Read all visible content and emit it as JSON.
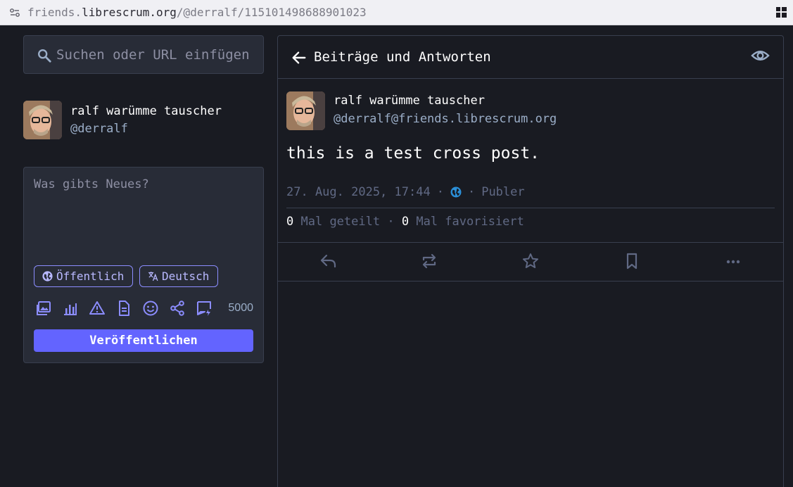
{
  "browser": {
    "url_prefix": "friends.",
    "url_domain": "librescrum.org",
    "url_path": "/@derralf/115101498688901023"
  },
  "sidebar": {
    "search_placeholder": "Suchen oder URL einfügen",
    "account": {
      "display_name": "ralf warümme tauscher",
      "handle": "@derralf"
    },
    "composer": {
      "placeholder": "Was gibts Neues?",
      "visibility_label": "Öffentlich",
      "language_label": "Deutsch",
      "char_counter": "5000",
      "publish_label": "Veröffentlichen"
    }
  },
  "column": {
    "title": "Beiträge und Antworten"
  },
  "status": {
    "display_name": "ralf warümme tauscher",
    "acct": "@derralf@friends.librescrum.org",
    "content": "this is a test cross post.",
    "timestamp": "27. Aug. 2025, 17:44",
    "separator": "·",
    "application": "Publer",
    "boosts_count": "0",
    "boosts_label": "Mal geteilt",
    "favourites_count": "0",
    "favourites_label": "Mal favorisiert"
  },
  "colors": {
    "background": "#191b22",
    "surface": "#282c37",
    "accent": "#6364ff",
    "muted_text": "#606984",
    "secondary_text": "#9baec8",
    "icon_purple": "#8c8dff"
  }
}
